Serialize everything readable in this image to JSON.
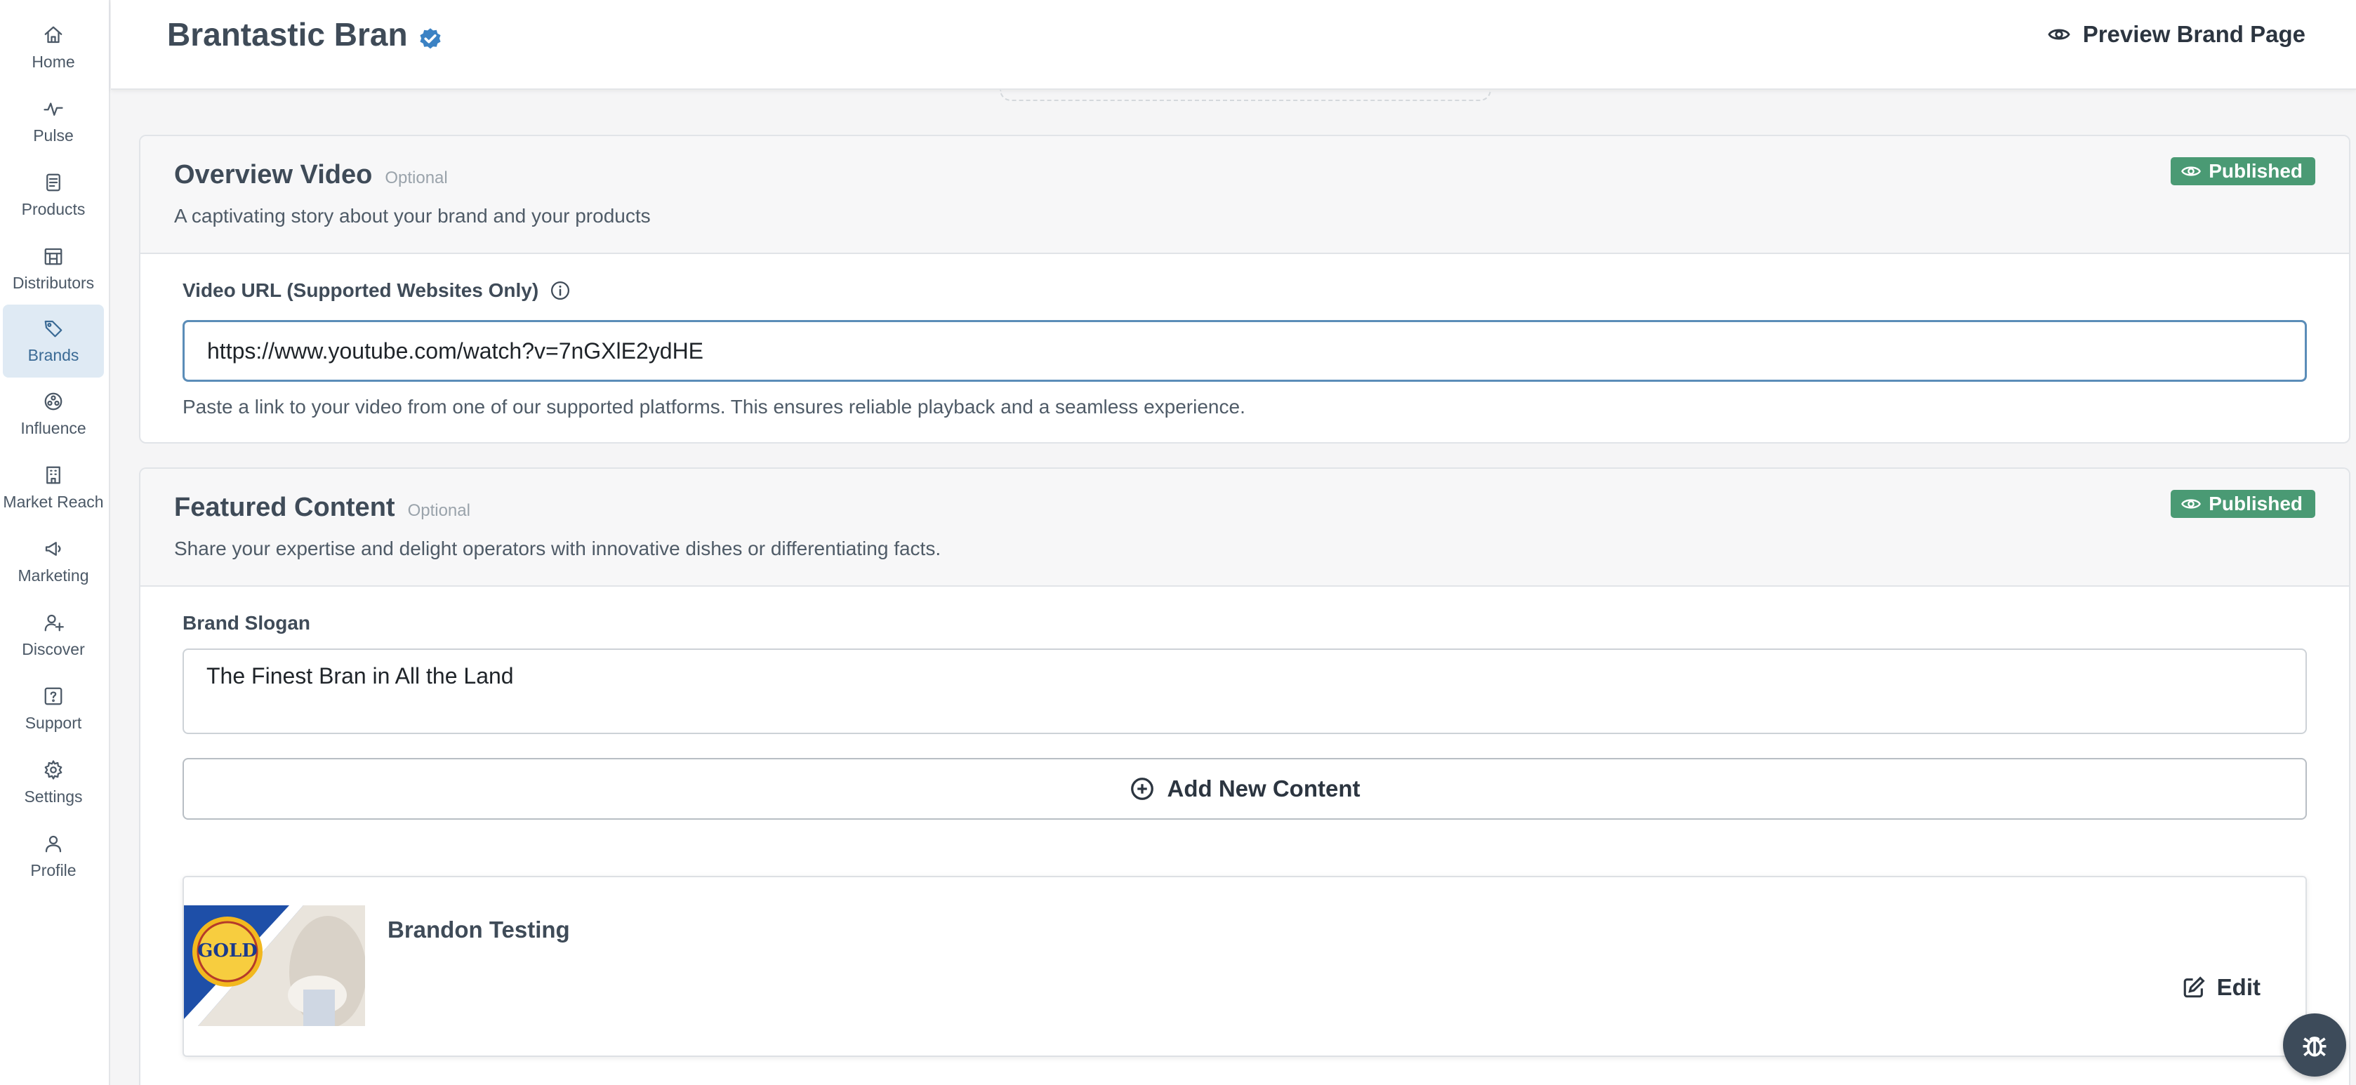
{
  "sidebar": {
    "items": [
      {
        "label": "Home",
        "icon": "home-icon"
      },
      {
        "label": "Pulse",
        "icon": "pulse-icon"
      },
      {
        "label": "Products",
        "icon": "products-icon"
      },
      {
        "label": "Distributors",
        "icon": "distributors-icon"
      },
      {
        "label": "Brands",
        "icon": "tag-icon",
        "active": true
      },
      {
        "label": "Influence",
        "icon": "influence-icon"
      },
      {
        "label": "Market Reach",
        "icon": "building-icon"
      },
      {
        "label": "Marketing",
        "icon": "megaphone-icon"
      },
      {
        "label": "Discover",
        "icon": "user-plus-icon"
      },
      {
        "label": "Support",
        "icon": "help-icon"
      },
      {
        "label": "Settings",
        "icon": "gear-icon"
      },
      {
        "label": "Profile",
        "icon": "user-icon"
      }
    ]
  },
  "header": {
    "brand_name": "Brantastic Bran",
    "preview_label": "Preview Brand Page"
  },
  "overview_video": {
    "title": "Overview Video",
    "optional_label": "Optional",
    "description": "A captivating story about your brand and your products",
    "status": "Published",
    "field_label": "Video URL (Supported Websites Only)",
    "url_value": "https://www.youtube.com/watch?v=7nGXlE2ydHE",
    "helper": "Paste a link to your video from one of our supported platforms. This ensures reliable playback and a seamless experience."
  },
  "featured_content": {
    "title": "Featured Content",
    "optional_label": "Optional",
    "description": "Share your expertise and delight operators with innovative dishes or differentiating facts.",
    "status": "Published",
    "slogan_label": "Brand Slogan",
    "slogan_value": "The Finest Bran in All the Land",
    "add_label": "Add New Content",
    "items": [
      {
        "title": "Brandon Testing",
        "edit_label": "Edit",
        "thumb_text": "GOLD"
      }
    ]
  },
  "colors": {
    "accent": "#5b8db8",
    "published": "#4a9a74",
    "active_nav": "#dfeaf4",
    "verified": "#3b82c4"
  }
}
